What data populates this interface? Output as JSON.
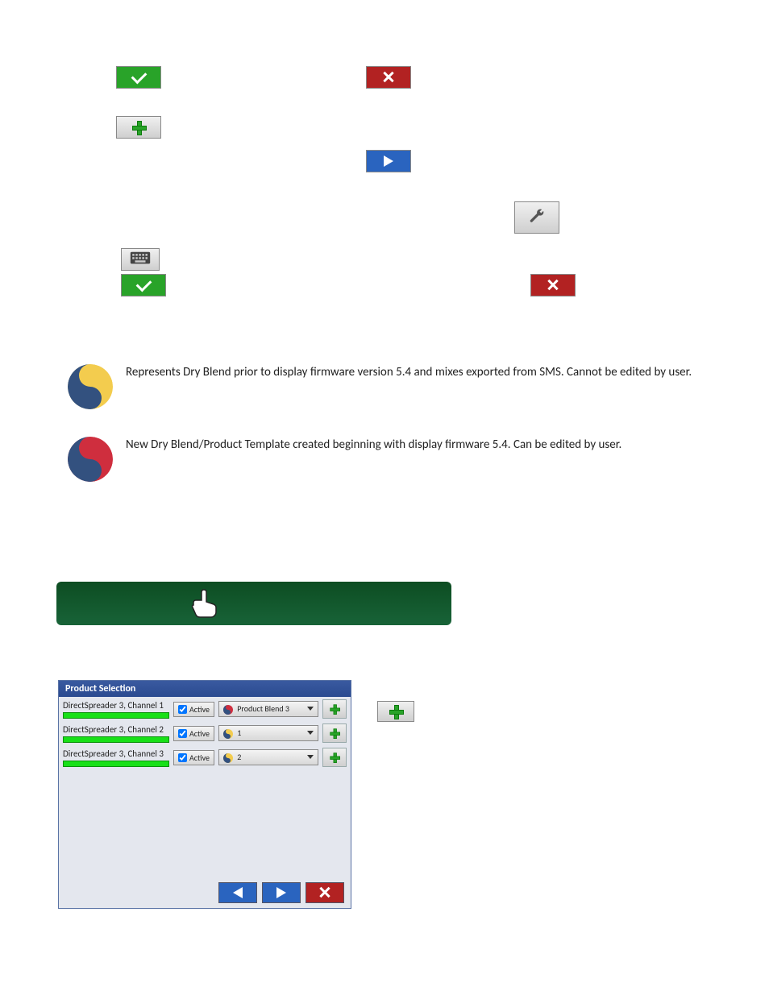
{
  "buttons": {
    "accept": "accept / confirm",
    "cancel": "cancel",
    "add": "add",
    "next": "next / play",
    "wrench": "settings / tool",
    "keyboard": "keyboard",
    "accept2": "accept",
    "cancel2": "cancel"
  },
  "blend_icons": {
    "legacy": "Represents Dry Blend prior to display firmware version 5.4 and mixes exported from SMS. Cannot be edited by user.",
    "new": "New Dry Blend/Product Template created beginning with display firmware 5.4. Can be edited by user."
  },
  "product_selection": {
    "title": "Product Selection",
    "active_label": "Active",
    "rows": [
      {
        "channel": "DirectSpreader 3, Channel 1",
        "product": "Product Blend 3"
      },
      {
        "channel": "DirectSpreader 3, Channel 2",
        "product": "1"
      },
      {
        "channel": "DirectSpreader 3, Channel 3",
        "product": "2"
      }
    ]
  }
}
